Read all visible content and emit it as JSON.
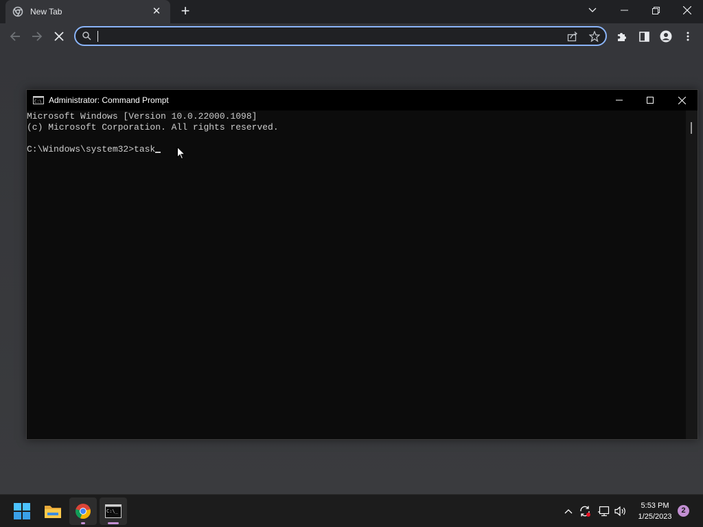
{
  "browser": {
    "tab_title": "New Tab",
    "omnibox_value": "",
    "omnibox_placeholder": ""
  },
  "cmd": {
    "title": "Administrator: Command Prompt",
    "lines": [
      "Microsoft Windows [Version 10.0.22000.1098]",
      "(c) Microsoft Corporation. All rights reserved.",
      "",
      "C:\\Windows\\system32>task"
    ]
  },
  "taskbar": {
    "time": "5:53 PM",
    "date": "1/25/2023",
    "notification_count": "2"
  },
  "colors": {
    "accent": "#8ab4f8",
    "console_bg": "#0c0c0c",
    "console_text": "#cccccc",
    "taskbar_bg": "#1c1c1c"
  }
}
